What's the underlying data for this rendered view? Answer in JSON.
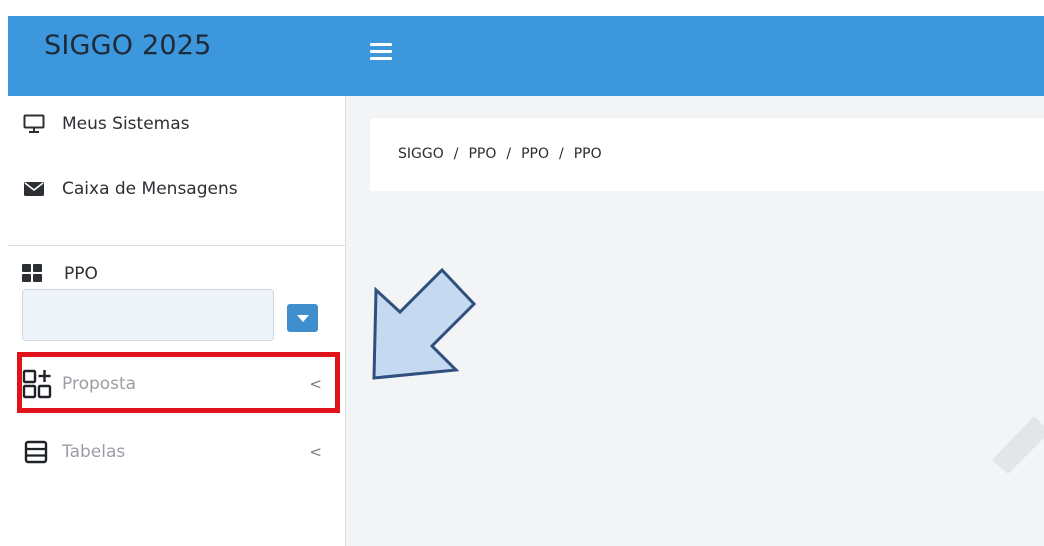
{
  "app": {
    "title": "SIGGO 2025"
  },
  "sidebar": {
    "links": [
      {
        "label": "Meus Sistemas",
        "icon": "monitor-icon"
      },
      {
        "label": "Caixa de Mensagens",
        "icon": "envelope-icon"
      }
    ],
    "module": {
      "label": "PPO",
      "icon": "grid-icon"
    },
    "select": {
      "value": ""
    },
    "menu": [
      {
        "label": "Proposta",
        "icon": "add-module-icon",
        "chevron": "<"
      },
      {
        "label": "Tabelas",
        "icon": "table-icon",
        "chevron": "<"
      }
    ]
  },
  "breadcrumb": [
    "SIGGO",
    "PPO",
    "PPO",
    "PPO"
  ],
  "breadcrumb_separator": "/",
  "colors": {
    "topbar": "#3c97dc",
    "highlight": "#e0131c",
    "arrow_fill": "#c5d9f1",
    "arrow_stroke": "#2f4f7f"
  }
}
